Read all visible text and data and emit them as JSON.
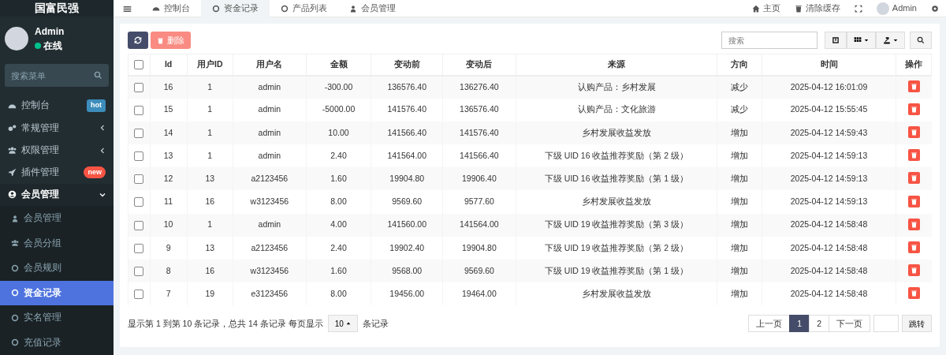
{
  "brand": {
    "title": "国富民强"
  },
  "user": {
    "name": "Admin",
    "status": "在线"
  },
  "sidebar": {
    "search": {
      "placeholder": "搜索菜单"
    },
    "items": [
      {
        "label": "控制台",
        "badge": "hot",
        "color": "#3c8dbc",
        "expanded": false
      },
      {
        "label": "常规管理",
        "expanded": false
      },
      {
        "label": "权限管理",
        "expanded": false
      },
      {
        "label": "插件管理",
        "badge": "new",
        "color": "#f75444",
        "expanded": false
      },
      {
        "label": "会员管理",
        "expanded": true,
        "children": [
          {
            "label": "会员管理",
            "selected": false
          },
          {
            "label": "会员分组",
            "selected": false
          },
          {
            "label": "会员规则",
            "selected": false
          },
          {
            "label": "资金记录",
            "selected": true
          },
          {
            "label": "实名管理",
            "selected": false
          },
          {
            "label": "充值记录",
            "selected": false
          }
        ]
      }
    ]
  },
  "tabs": [
    {
      "label": "控制台",
      "selected": false
    },
    {
      "label": "资金记录",
      "selected": true
    },
    {
      "label": "产品列表",
      "selected": false
    },
    {
      "label": "会员管理",
      "selected": false
    }
  ],
  "header_links": [
    {
      "label": "主页"
    },
    {
      "label": "清除缓存"
    }
  ],
  "header_user": "Admin",
  "toolbar": {
    "delete": "删除",
    "search": {
      "placeholder": "搜索"
    }
  },
  "table": {
    "select_all": {
      "checked": false
    },
    "columns": [
      "Id",
      "用户ID",
      "用户名",
      "金额",
      "变动前",
      "变动后",
      "来源",
      "方向",
      "时间",
      "操作"
    ],
    "rows": [
      {
        "checked": false,
        "cells": [
          "16",
          "1",
          "admin",
          "-300.00",
          "136576.40",
          "136276.40",
          "认购产品：乡村发展",
          "减少",
          "2025-04-12 16:01:09"
        ]
      },
      {
        "checked": false,
        "cells": [
          "15",
          "1",
          "admin",
          "-5000.00",
          "141576.40",
          "136576.40",
          "认购产品：文化旅游",
          "减少",
          "2025-04-12 15:55:45"
        ]
      },
      {
        "checked": false,
        "cells": [
          "14",
          "1",
          "admin",
          "10.00",
          "141566.40",
          "141576.40",
          "乡村发展收益发放",
          "增加",
          "2025-04-12 14:59:43"
        ]
      },
      {
        "checked": false,
        "cells": [
          "13",
          "1",
          "admin",
          "2.40",
          "141564.00",
          "141566.40",
          "下级 UID 16 收益推荐奖励（第 2 级）",
          "增加",
          "2025-04-12 14:59:13"
        ]
      },
      {
        "checked": false,
        "cells": [
          "12",
          "13",
          "a2123456",
          "1.60",
          "19904.80",
          "19906.40",
          "下级 UID 16 收益推荐奖励（第 1 级）",
          "增加",
          "2025-04-12 14:59:13"
        ]
      },
      {
        "checked": false,
        "cells": [
          "11",
          "16",
          "w3123456",
          "8.00",
          "9569.60",
          "9577.60",
          "乡村发展收益发放",
          "增加",
          "2025-04-12 14:59:13"
        ]
      },
      {
        "checked": false,
        "cells": [
          "10",
          "1",
          "admin",
          "4.00",
          "141560.00",
          "141564.00",
          "下级 UID 19 收益推荐奖励（第 3 级）",
          "增加",
          "2025-04-12 14:58:48"
        ]
      },
      {
        "checked": false,
        "cells": [
          "9",
          "13",
          "a2123456",
          "2.40",
          "19902.40",
          "19904.80",
          "下级 UID 19 收益推荐奖励（第 2 级）",
          "增加",
          "2025-04-12 14:58:48"
        ]
      },
      {
        "checked": false,
        "cells": [
          "8",
          "16",
          "w3123456",
          "1.60",
          "9568.00",
          "9569.60",
          "下级 UID 19 收益推荐奖励（第 1 级）",
          "增加",
          "2025-04-12 14:58:48"
        ]
      },
      {
        "checked": false,
        "cells": [
          "7",
          "19",
          "e3123456",
          "8.00",
          "19456.00",
          "19464.00",
          "乡村发展收益发放",
          "增加",
          "2025-04-12 14:58:48"
        ]
      }
    ]
  },
  "footer": {
    "summary": "显示第 1 到第 10 条记录，总共 14 条记录 每页显示",
    "page_size": "10",
    "suffix": "条记录"
  },
  "pagination": {
    "prev": "上一页",
    "pages": [
      {
        "label": "1",
        "selected": true
      },
      {
        "label": "2",
        "selected": false
      }
    ],
    "next": "下一页",
    "jump": "跳转"
  }
}
